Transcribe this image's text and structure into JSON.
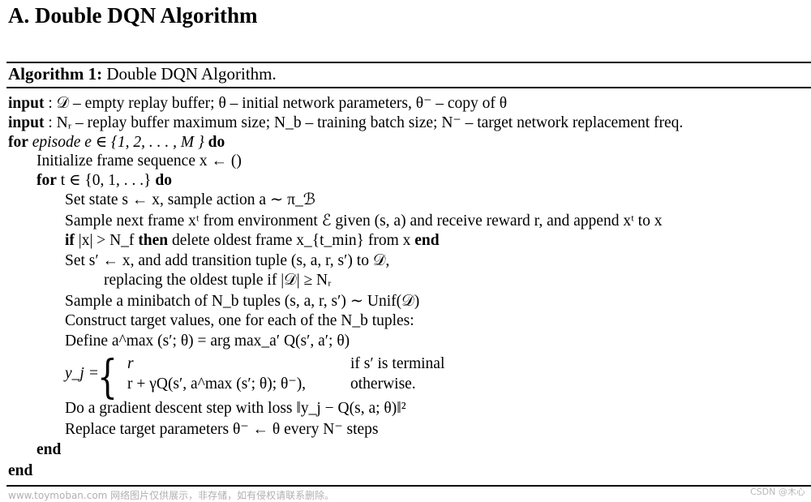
{
  "section_title": "A. Double DQN Algorithm",
  "algorithm": {
    "label": "Algorithm 1:",
    "caption": "Double DQN Algorithm."
  },
  "lines": {
    "input1_kw": "input",
    "input1_text": " : 𝒟 – empty replay buffer; θ – initial network parameters, θ⁻ – copy of θ",
    "input2_kw": "input",
    "input2_text": " : Nᵣ – replay buffer maximum size; N_b – training batch size; N⁻ – target network replacement freq.",
    "for_episode_kw": "for",
    "for_episode_text": " episode e ∈ {1, 2, . . . , M } ",
    "do_kw": "do",
    "init_frames": "Initialize frame sequence x ← ()",
    "for_t_kw": "for",
    "for_t_text": " t ∈ {0, 1, . . .} ",
    "set_state": "Set state s ← x, sample action a ∼ π_ℬ",
    "sample_next": "Sample next frame xᵗ from environment ℰ given (s, a) and receive reward r, and append xᵗ to x",
    "if_kw": "if",
    "if_cond": " |x| > N_f ",
    "then_kw": "then",
    "if_body": " delete oldest frame x_{t_min} from x ",
    "end_kw": "end",
    "set_sprime": "Set s′ ← x, and add transition tuple (s, a, r, s′) to 𝒟,",
    "replacing": "replacing the oldest tuple if |𝒟| ≥ Nᵣ",
    "sample_minibatch": "Sample a minibatch of N_b tuples (s, a, r, s′) ∼ Unif(𝒟)",
    "construct_targets": "Construct target values, one for each of the N_b tuples:",
    "define_amax": "Define a^max (s′; θ) = arg max_a′ Q(s′, a′; θ)",
    "yj_lhs": "y_j =",
    "case1_expr": "r",
    "case1_cond": "if s′ is terminal",
    "case2_expr": "r + γQ(s′, a^max (s′; θ); θ⁻),",
    "case2_cond": "otherwise.",
    "gradient_step": "Do a gradient descent step with loss ‖y_j − Q(s, a; θ)‖²",
    "replace_target": "Replace target parameters θ⁻ ← θ every N⁻ steps",
    "end_inner": "end",
    "end_outer": "end"
  },
  "watermark": {
    "left": "www.toymoban.com 网络图片仅供展示，非存储，如有侵权请联系删除。",
    "right": "CSDN @木心"
  }
}
